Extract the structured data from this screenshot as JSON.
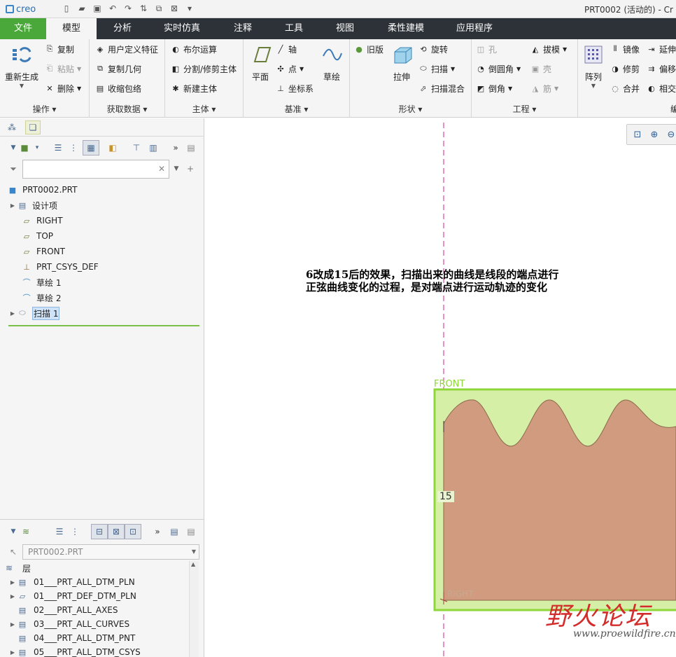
{
  "app": {
    "logo": "creo",
    "window_title": "PRT0002 (活动的) - Cr"
  },
  "tabs": [
    {
      "label": "文件"
    },
    {
      "label": "模型"
    },
    {
      "label": "分析"
    },
    {
      "label": "实时仿真"
    },
    {
      "label": "注释"
    },
    {
      "label": "工具"
    },
    {
      "label": "视图"
    },
    {
      "label": "柔性建模"
    },
    {
      "label": "应用程序"
    }
  ],
  "ribbon": {
    "operations": {
      "label": "操作",
      "regenerate": "重新生成",
      "copy": "复制",
      "paste": "粘贴",
      "delete": "删除"
    },
    "get_data": {
      "label": "获取数据",
      "udf": "用户定义特征",
      "copy_geom": "复制几何",
      "shrinkwrap": "收缩包络"
    },
    "body": {
      "label": "主体",
      "boolean": "布尔运算",
      "split": "分割/修剪主体",
      "new_body": "新建主体"
    },
    "datum": {
      "label": "基准",
      "plane": "平面",
      "axis": "轴",
      "point": "点",
      "csys": "坐标系",
      "sketch": "草绘"
    },
    "shapes": {
      "label": "形状",
      "legacy": "旧版",
      "extrude": "拉伸",
      "revolve": "旋转",
      "sweep": "扫描",
      "swept_blend": "扫描混合"
    },
    "engineering": {
      "label": "工程",
      "hole": "孔",
      "round": "倒圆角",
      "chamfer": "倒角",
      "draft": "拔模",
      "shell": "壳",
      "rib": "筋"
    },
    "editing": {
      "label": "编",
      "pattern": "阵列",
      "mirror": "镜像",
      "extend": "延伸",
      "trim": "修剪",
      "offset": "偏移",
      "merge": "合并",
      "intersect": "相交"
    }
  },
  "model_tree": {
    "filter_placeholder": "",
    "items": [
      {
        "label": "PRT0002.PRT",
        "icon": "part-icon"
      },
      {
        "label": "设计项",
        "icon": "design-items-icon"
      },
      {
        "label": "RIGHT",
        "icon": "datum-plane-icon"
      },
      {
        "label": "TOP",
        "icon": "datum-plane-icon"
      },
      {
        "label": "FRONT",
        "icon": "datum-plane-icon"
      },
      {
        "label": "PRT_CSYS_DEF",
        "icon": "csys-icon"
      },
      {
        "label": "草绘 1",
        "icon": "sketch-icon"
      },
      {
        "label": "草绘 2",
        "icon": "sketch-icon"
      },
      {
        "label": "扫描 1",
        "icon": "sweep-icon"
      }
    ]
  },
  "layer_tree": {
    "model": "PRT0002.PRT",
    "header": "层",
    "items": [
      {
        "label": "01___PRT_ALL_DTM_PLN"
      },
      {
        "label": "01___PRT_DEF_DTM_PLN"
      },
      {
        "label": "02___PRT_ALL_AXES"
      },
      {
        "label": "03___PRT_ALL_CURVES"
      },
      {
        "label": "04___PRT_ALL_DTM_PNT"
      },
      {
        "label": "05___PRT_ALL_DTM_CSYS"
      }
    ]
  },
  "viewport": {
    "annotation_line1": "6改成15后的效果，扫描出来的曲线是线段的端点进行",
    "annotation_line2": "正弦曲线变化的过程，是对端点进行运动轨迹的变化",
    "front_label": "FRONT",
    "dimension": "15",
    "right_label": "RIGHT"
  },
  "watermark": {
    "title": "野火论坛",
    "url": "www.proewildfire.cn"
  },
  "colors": {
    "accent_green": "#4aa83a",
    "tab_bar": "#2d3238",
    "sweep_fill": "#d19b80",
    "plane_fill": "#d6efa6",
    "plane_edge": "#8fd63a",
    "centerline": "#e0479e"
  }
}
